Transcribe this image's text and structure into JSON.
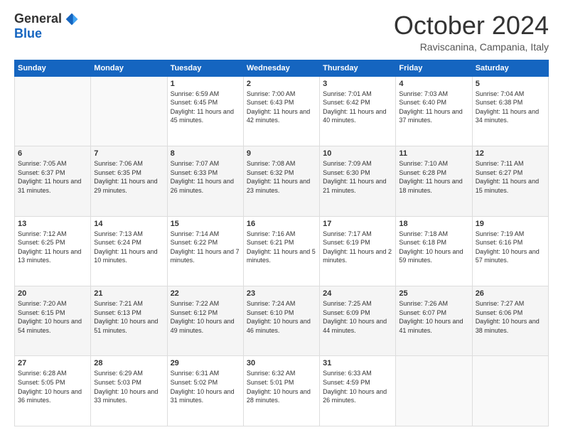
{
  "logo": {
    "general": "General",
    "blue": "Blue"
  },
  "header": {
    "month": "October 2024",
    "location": "Raviscanina, Campania, Italy"
  },
  "days_of_week": [
    "Sunday",
    "Monday",
    "Tuesday",
    "Wednesday",
    "Thursday",
    "Friday",
    "Saturday"
  ],
  "weeks": [
    [
      {
        "day": "",
        "info": ""
      },
      {
        "day": "",
        "info": ""
      },
      {
        "day": "1",
        "info": "Sunrise: 6:59 AM\nSunset: 6:45 PM\nDaylight: 11 hours and 45 minutes."
      },
      {
        "day": "2",
        "info": "Sunrise: 7:00 AM\nSunset: 6:43 PM\nDaylight: 11 hours and 42 minutes."
      },
      {
        "day": "3",
        "info": "Sunrise: 7:01 AM\nSunset: 6:42 PM\nDaylight: 11 hours and 40 minutes."
      },
      {
        "day": "4",
        "info": "Sunrise: 7:03 AM\nSunset: 6:40 PM\nDaylight: 11 hours and 37 minutes."
      },
      {
        "day": "5",
        "info": "Sunrise: 7:04 AM\nSunset: 6:38 PM\nDaylight: 11 hours and 34 minutes."
      }
    ],
    [
      {
        "day": "6",
        "info": "Sunrise: 7:05 AM\nSunset: 6:37 PM\nDaylight: 11 hours and 31 minutes."
      },
      {
        "day": "7",
        "info": "Sunrise: 7:06 AM\nSunset: 6:35 PM\nDaylight: 11 hours and 29 minutes."
      },
      {
        "day": "8",
        "info": "Sunrise: 7:07 AM\nSunset: 6:33 PM\nDaylight: 11 hours and 26 minutes."
      },
      {
        "day": "9",
        "info": "Sunrise: 7:08 AM\nSunset: 6:32 PM\nDaylight: 11 hours and 23 minutes."
      },
      {
        "day": "10",
        "info": "Sunrise: 7:09 AM\nSunset: 6:30 PM\nDaylight: 11 hours and 21 minutes."
      },
      {
        "day": "11",
        "info": "Sunrise: 7:10 AM\nSunset: 6:28 PM\nDaylight: 11 hours and 18 minutes."
      },
      {
        "day": "12",
        "info": "Sunrise: 7:11 AM\nSunset: 6:27 PM\nDaylight: 11 hours and 15 minutes."
      }
    ],
    [
      {
        "day": "13",
        "info": "Sunrise: 7:12 AM\nSunset: 6:25 PM\nDaylight: 11 hours and 13 minutes."
      },
      {
        "day": "14",
        "info": "Sunrise: 7:13 AM\nSunset: 6:24 PM\nDaylight: 11 hours and 10 minutes."
      },
      {
        "day": "15",
        "info": "Sunrise: 7:14 AM\nSunset: 6:22 PM\nDaylight: 11 hours and 7 minutes."
      },
      {
        "day": "16",
        "info": "Sunrise: 7:16 AM\nSunset: 6:21 PM\nDaylight: 11 hours and 5 minutes."
      },
      {
        "day": "17",
        "info": "Sunrise: 7:17 AM\nSunset: 6:19 PM\nDaylight: 11 hours and 2 minutes."
      },
      {
        "day": "18",
        "info": "Sunrise: 7:18 AM\nSunset: 6:18 PM\nDaylight: 10 hours and 59 minutes."
      },
      {
        "day": "19",
        "info": "Sunrise: 7:19 AM\nSunset: 6:16 PM\nDaylight: 10 hours and 57 minutes."
      }
    ],
    [
      {
        "day": "20",
        "info": "Sunrise: 7:20 AM\nSunset: 6:15 PM\nDaylight: 10 hours and 54 minutes."
      },
      {
        "day": "21",
        "info": "Sunrise: 7:21 AM\nSunset: 6:13 PM\nDaylight: 10 hours and 51 minutes."
      },
      {
        "day": "22",
        "info": "Sunrise: 7:22 AM\nSunset: 6:12 PM\nDaylight: 10 hours and 49 minutes."
      },
      {
        "day": "23",
        "info": "Sunrise: 7:24 AM\nSunset: 6:10 PM\nDaylight: 10 hours and 46 minutes."
      },
      {
        "day": "24",
        "info": "Sunrise: 7:25 AM\nSunset: 6:09 PM\nDaylight: 10 hours and 44 minutes."
      },
      {
        "day": "25",
        "info": "Sunrise: 7:26 AM\nSunset: 6:07 PM\nDaylight: 10 hours and 41 minutes."
      },
      {
        "day": "26",
        "info": "Sunrise: 7:27 AM\nSunset: 6:06 PM\nDaylight: 10 hours and 38 minutes."
      }
    ],
    [
      {
        "day": "27",
        "info": "Sunrise: 6:28 AM\nSunset: 5:05 PM\nDaylight: 10 hours and 36 minutes."
      },
      {
        "day": "28",
        "info": "Sunrise: 6:29 AM\nSunset: 5:03 PM\nDaylight: 10 hours and 33 minutes."
      },
      {
        "day": "29",
        "info": "Sunrise: 6:31 AM\nSunset: 5:02 PM\nDaylight: 10 hours and 31 minutes."
      },
      {
        "day": "30",
        "info": "Sunrise: 6:32 AM\nSunset: 5:01 PM\nDaylight: 10 hours and 28 minutes."
      },
      {
        "day": "31",
        "info": "Sunrise: 6:33 AM\nSunset: 4:59 PM\nDaylight: 10 hours and 26 minutes."
      },
      {
        "day": "",
        "info": ""
      },
      {
        "day": "",
        "info": ""
      }
    ]
  ]
}
